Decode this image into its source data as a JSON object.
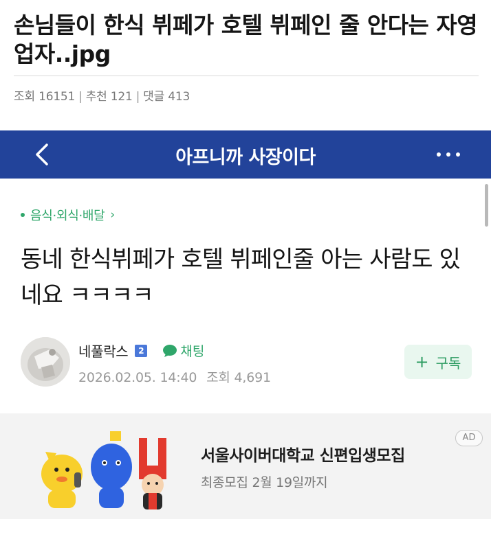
{
  "post": {
    "title": "손님들이 한식 뷔페가 호텔 뷔페인 줄 안다는 자영업자..jpg",
    "views": "조회 16151",
    "recommends": "추천 121",
    "comments": "댓글 413"
  },
  "app": {
    "title": "아프니까 사장이다",
    "back_icon": "chevron-left-icon",
    "more_icon": "more-horizontal-icon"
  },
  "article": {
    "category": "음식·외식·배달",
    "title": "동네 한식뷔페가 호텔 뷔페인줄 아는 사람도 있네요 ㅋㅋㅋㅋ",
    "author": "네풀락스",
    "level": "2",
    "chat_label": "채팅",
    "date": "2026.02.05. 14:40",
    "views": "조회 4,691",
    "subscribe_label": "구독",
    "subscribe_plus": "+"
  },
  "ad": {
    "badge": "AD",
    "title": "서울사이버대학교 신편입생모집",
    "subtitle": "최종모집 2월 19일까지"
  },
  "colors": {
    "appbar": "#22439a",
    "accent_green": "#2fa66a",
    "level_blue": "#4a78d9"
  }
}
